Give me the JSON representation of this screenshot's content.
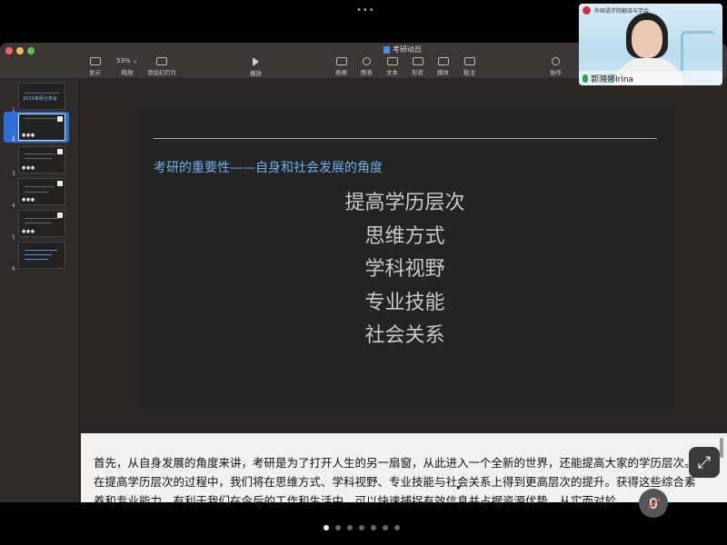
{
  "top_bar": {
    "dots": "•••"
  },
  "window": {
    "title": "考研动员",
    "toolbar": [
      {
        "label": "显示",
        "icon": "sidebar-view-icon"
      },
      {
        "label": "缩放",
        "value": "53%",
        "icon": "chevron-down-icon"
      },
      {
        "label": "添加幻灯片",
        "icon": "add-slide-icon"
      },
      {
        "label": "播放",
        "icon": "play-icon"
      },
      {
        "label": "表格",
        "icon": "table-icon"
      },
      {
        "label": "图表",
        "icon": "chart-icon"
      },
      {
        "label": "文本",
        "icon": "text-box-icon"
      },
      {
        "label": "形状",
        "icon": "shape-icon"
      },
      {
        "label": "媒体",
        "icon": "media-icon"
      },
      {
        "label": "批注",
        "icon": "comment-icon"
      },
      {
        "label": "协作",
        "icon": "collaborate-icon"
      }
    ]
  },
  "sidebar": {
    "slides": [
      {
        "number": "1",
        "thumb_text": "2022考研分享会",
        "selected": false
      },
      {
        "number": "2",
        "thumb_text": "",
        "selected": true
      },
      {
        "number": "3",
        "thumb_text": "",
        "selected": false
      },
      {
        "number": "4",
        "thumb_text": "",
        "selected": false
      },
      {
        "number": "5",
        "thumb_text": "",
        "selected": false
      },
      {
        "number": "6",
        "thumb_text": "",
        "selected": false
      }
    ]
  },
  "slide": {
    "heading": "考研的重要性——自身和社会发展的角度",
    "items": [
      "提高学历层次",
      "思维方式",
      "学科视野",
      "专业技能",
      "社会关系"
    ]
  },
  "notes": {
    "text": "首先，从自身发展的角度来讲，考研是为了打开人生的另一扇窗，从此进入一个全新的世界，还能提高大家的学历层次。在提高学历层次的过程中，我们将在思维方式、学科视野、专业技能与社会关系上得到更高层次的提升。获得这些综合素养和专业能力，有利于我们在今后的工作和生活中，可以快速捕捉有效信息并占据资源优势，从实而对於"
  },
  "video": {
    "header": "外国语学院翻译与学会",
    "participant_name": "郭漪娜Irina"
  },
  "pager": {
    "count": 7,
    "active_index": 0
  },
  "colors": {
    "accent": "#2f6fd4",
    "heading": "#6fb0e8"
  }
}
